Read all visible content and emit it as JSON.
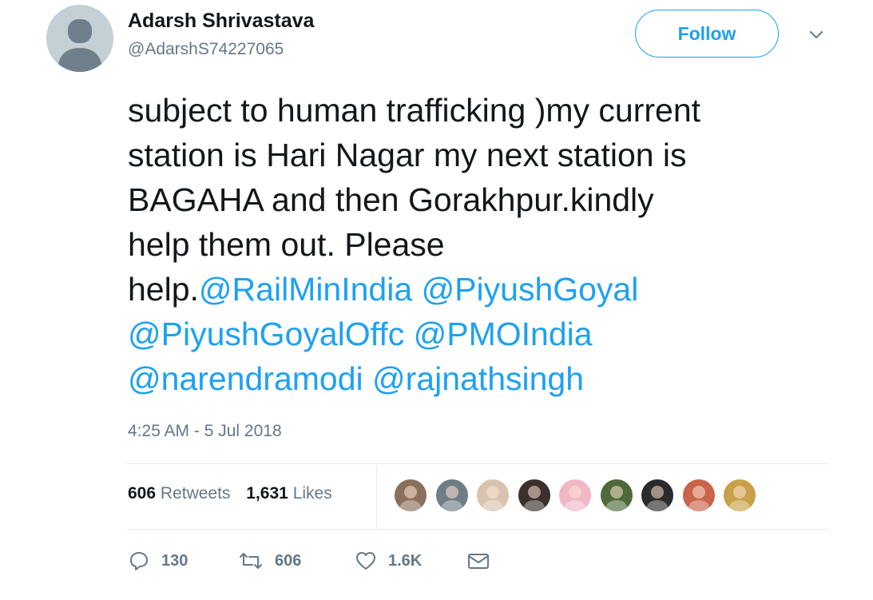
{
  "user": {
    "name": "Adarsh Shrivastava",
    "handle": "@AdarshS74227065",
    "follow_label": "Follow"
  },
  "tweet": {
    "lines": [
      [
        {
          "text": "subject to human trafficking )my current",
          "mention": false
        }
      ],
      [
        {
          "text": "station is Hari Nagar my next station is",
          "mention": false
        }
      ],
      [
        {
          "text": "BAGAHA and then Gorakhpur.kindly",
          "mention": false
        }
      ],
      [
        {
          "text": "help them out. Please",
          "mention": false
        }
      ],
      [
        {
          "text": "help.",
          "mention": false
        },
        {
          "text": "@RailMinIndia",
          "mention": true
        },
        {
          "text": " ",
          "mention": false
        },
        {
          "text": "@PiyushGoyal",
          "mention": true
        }
      ],
      [
        {
          "text": "@PiyushGoyalOffc",
          "mention": true
        },
        {
          "text": " ",
          "mention": false
        },
        {
          "text": "@PMOIndia",
          "mention": true
        }
      ],
      [
        {
          "text": "@narendramodi",
          "mention": true
        },
        {
          "text": " ",
          "mention": false
        },
        {
          "text": "@rajnathsingh",
          "mention": true
        }
      ]
    ],
    "timestamp": "4:25 AM - 5 Jul 2018"
  },
  "stats": {
    "retweets_count": "606",
    "retweets_label": "Retweets",
    "likes_count": "1,631",
    "likes_label": "Likes"
  },
  "likers": [
    {
      "icon": "liker-avatar-1",
      "color": "#8a6f5c"
    },
    {
      "icon": "liker-avatar-2",
      "color": "#6f7d86"
    },
    {
      "icon": "liker-avatar-3",
      "color": "#d9c3b0"
    },
    {
      "icon": "liker-avatar-4",
      "color": "#3a302c"
    },
    {
      "icon": "liker-avatar-5",
      "color": "#f2b7c6"
    },
    {
      "icon": "liker-avatar-6",
      "color": "#4f6a3a"
    },
    {
      "icon": "liker-avatar-7",
      "color": "#2b2b2b"
    },
    {
      "icon": "liker-avatar-8",
      "color": "#c9634a"
    },
    {
      "icon": "liker-avatar-9",
      "color": "#c9a04a"
    }
  ],
  "actions": {
    "replies": "130",
    "retweets": "606",
    "likes": "1.6K"
  },
  "colors": {
    "accent": "#1da1f2",
    "muted": "#657786",
    "text": "#14171a",
    "divider": "#e6ecf0"
  }
}
